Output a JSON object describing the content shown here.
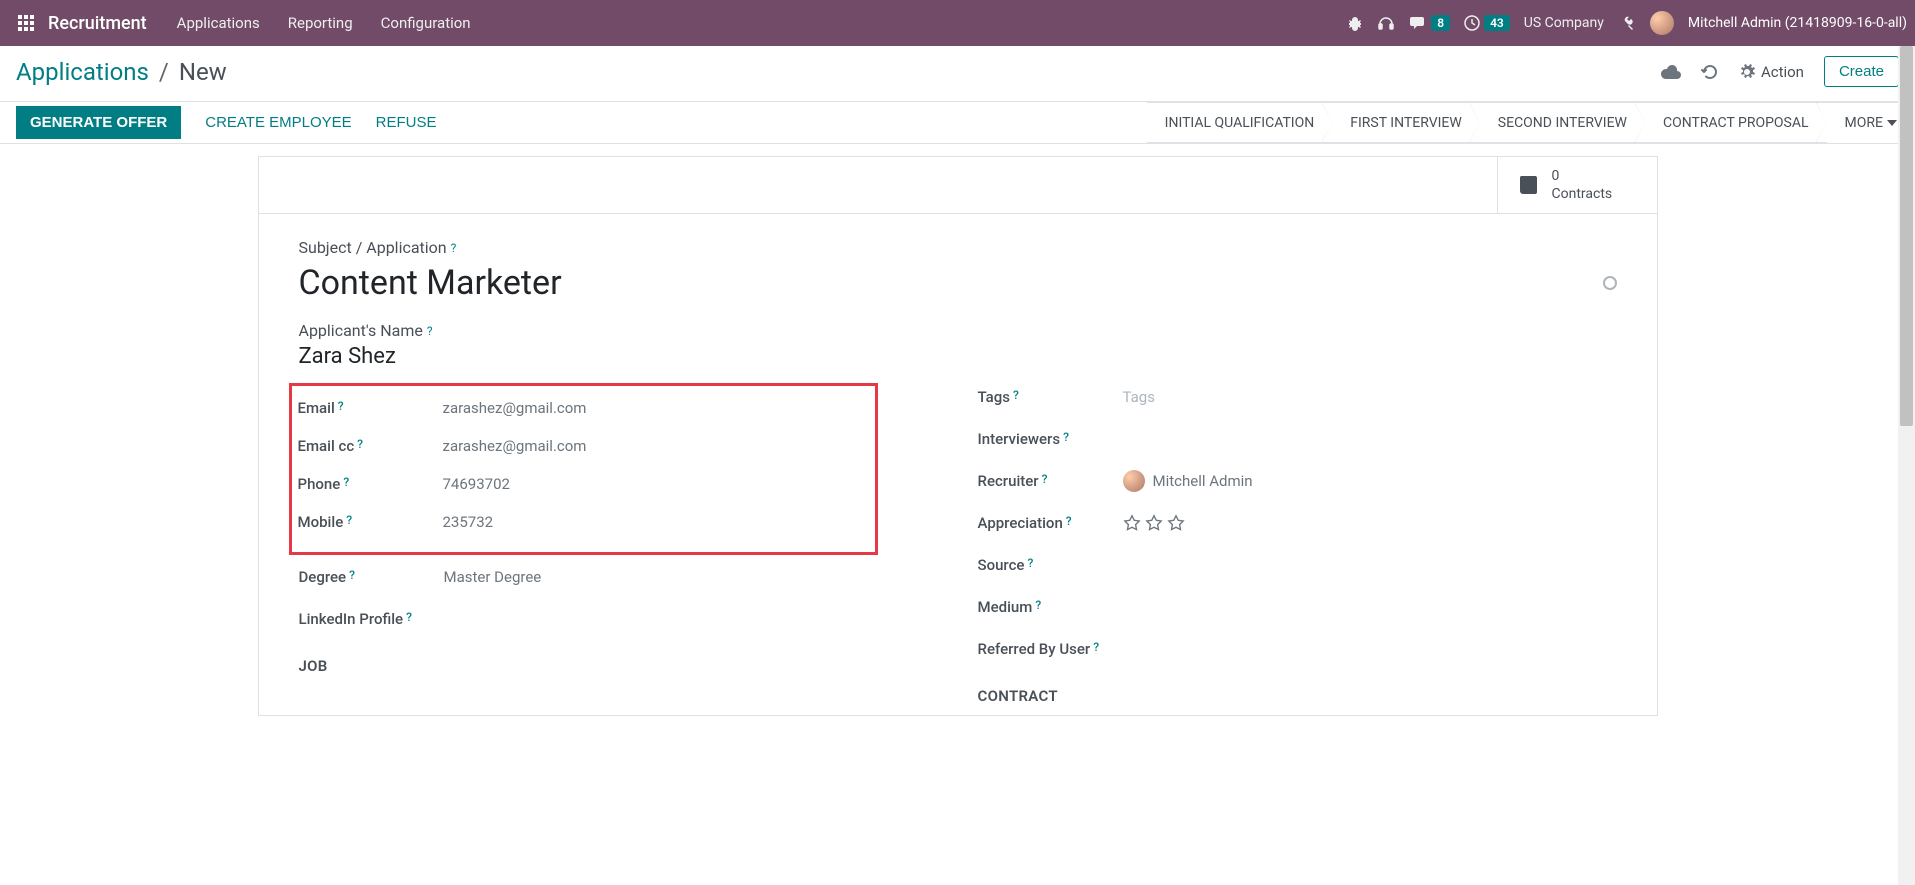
{
  "topbar": {
    "brand": "Recruitment",
    "nav": [
      "Applications",
      "Reporting",
      "Configuration"
    ],
    "chat_badge": "8",
    "activity_badge": "43",
    "company": "US Company",
    "user": "Mitchell Admin (21418909-16-0-all)"
  },
  "subheader": {
    "breadcrumb_root": "Applications",
    "breadcrumb_current": "New",
    "action_label": "Action",
    "create_label": "Create"
  },
  "actionbar": {
    "generate_offer": "GENERATE OFFER",
    "create_employee": "CREATE EMPLOYEE",
    "refuse": "REFUSE",
    "stages": [
      "INITIAL QUALIFICATION",
      "FIRST INTERVIEW",
      "SECOND INTERVIEW",
      "CONTRACT PROPOSAL"
    ],
    "more": "MORE"
  },
  "stat": {
    "count": "0",
    "label": "Contracts"
  },
  "form": {
    "subject_label": "Subject / Application",
    "subject_value": "Content Marketer",
    "name_label": "Applicant's Name",
    "name_value": "Zara Shez",
    "left": {
      "email_label": "Email",
      "email_value": "zarashez@gmail.com",
      "emailcc_label": "Email cc",
      "emailcc_value": "zarashez@gmail.com",
      "phone_label": "Phone",
      "phone_value": "74693702",
      "mobile_label": "Mobile",
      "mobile_value": "235732",
      "degree_label": "Degree",
      "degree_value": "Master Degree",
      "linkedin_label": "LinkedIn Profile"
    },
    "right": {
      "tags_label": "Tags",
      "tags_placeholder": "Tags",
      "interviewers_label": "Interviewers",
      "recruiter_label": "Recruiter",
      "recruiter_value": "Mitchell Admin",
      "appreciation_label": "Appreciation",
      "source_label": "Source",
      "medium_label": "Medium",
      "referred_label": "Referred By User"
    },
    "section_job": "JOB",
    "section_contract": "CONTRACT"
  }
}
